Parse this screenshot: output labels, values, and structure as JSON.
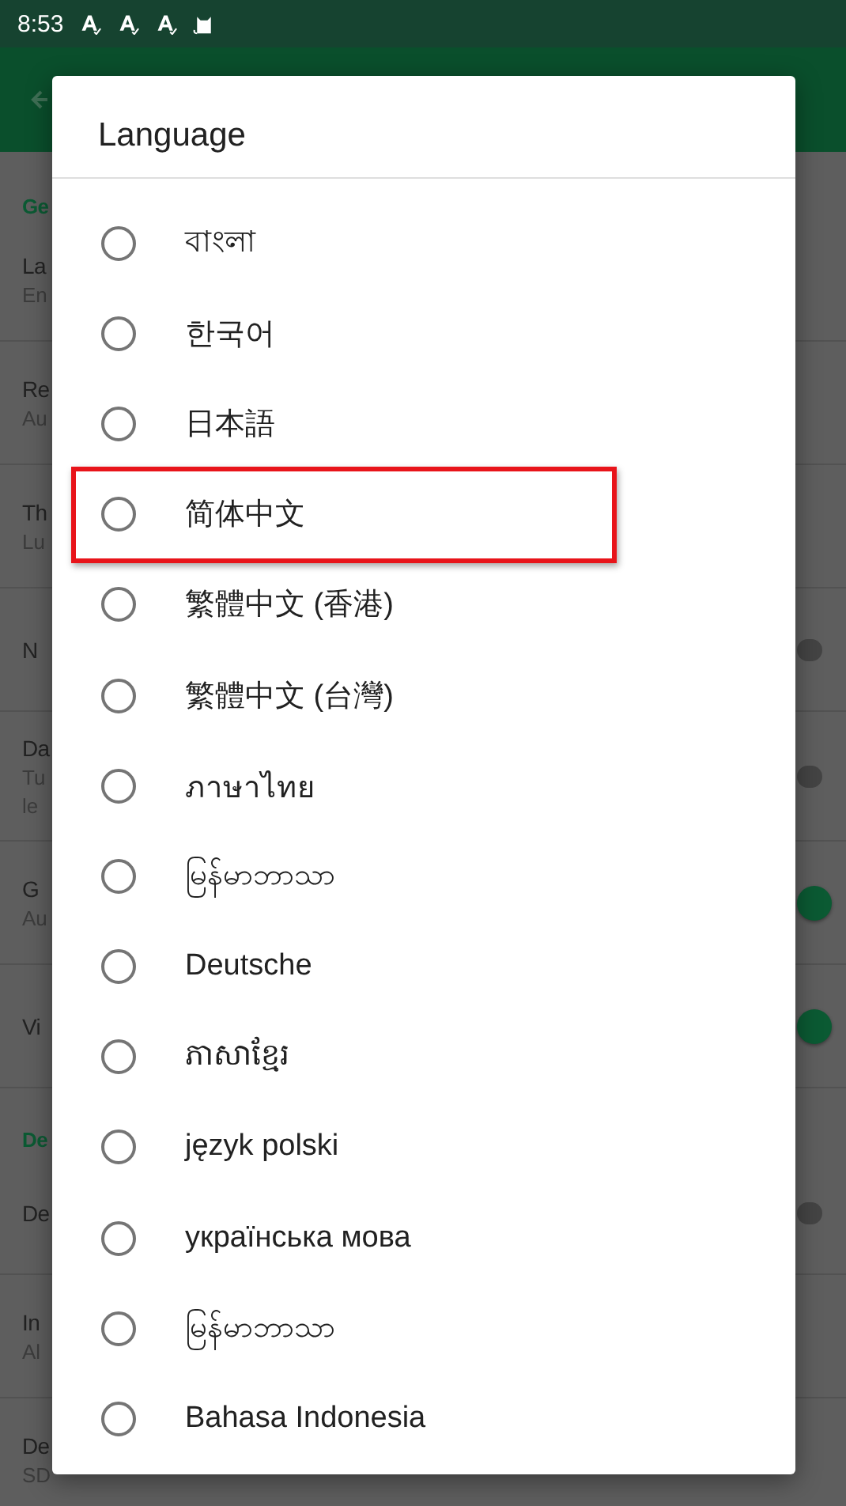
{
  "status_bar": {
    "time": "8:53"
  },
  "settings_behind": {
    "rows": [
      {
        "kind": "header",
        "title": "Ge"
      },
      {
        "kind": "item",
        "title": "La",
        "subtitle": [
          "En"
        ]
      },
      {
        "kind": "item",
        "title": "Re",
        "subtitle": [
          "Au"
        ]
      },
      {
        "kind": "item",
        "title": "Th",
        "subtitle": [
          "Lu"
        ]
      },
      {
        "kind": "toggle",
        "title": "N",
        "on": false
      },
      {
        "kind": "toggle",
        "title": "Da",
        "subtitle": [
          "Tu",
          "le"
        ],
        "on": false
      },
      {
        "kind": "toggle",
        "title": "G",
        "subtitle": [
          "Au"
        ],
        "on": true
      },
      {
        "kind": "toggle",
        "title": "Vi",
        "on": true
      },
      {
        "kind": "header",
        "title": "De"
      },
      {
        "kind": "toggle",
        "title": "De",
        "on": false
      },
      {
        "kind": "item",
        "title": "In",
        "subtitle": [
          "Al"
        ]
      },
      {
        "kind": "item",
        "title": "De",
        "subtitle": [
          "SD"
        ]
      }
    ]
  },
  "dialog": {
    "title": "Language",
    "items": [
      {
        "label": "বাংলা",
        "selected": false,
        "highlighted": false
      },
      {
        "label": "한국어",
        "selected": false,
        "highlighted": false
      },
      {
        "label": "日本語",
        "selected": false,
        "highlighted": false
      },
      {
        "label": "简体中文",
        "selected": false,
        "highlighted": true
      },
      {
        "label": "繁體中文 (香港)",
        "selected": false,
        "highlighted": false
      },
      {
        "label": "繁體中文 (台灣)",
        "selected": false,
        "highlighted": false
      },
      {
        "label": "ภาษาไทย",
        "selected": false,
        "highlighted": false
      },
      {
        "label": "မြန်မာဘာသာ",
        "selected": false,
        "highlighted": false
      },
      {
        "label": "Deutsche",
        "selected": false,
        "highlighted": false
      },
      {
        "label": "ភាសាខ្មែរ",
        "selected": false,
        "highlighted": false
      },
      {
        "label": "język polski",
        "selected": false,
        "highlighted": false
      },
      {
        "label": "українська мова",
        "selected": false,
        "highlighted": false
      },
      {
        "label": "မြန်မာဘာသာ",
        "selected": false,
        "highlighted": false
      },
      {
        "label": "Bahasa Indonesia",
        "selected": false,
        "highlighted": false
      }
    ]
  }
}
